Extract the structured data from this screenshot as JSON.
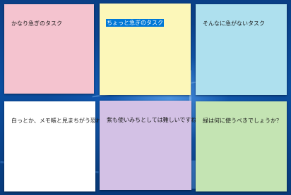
{
  "notes": [
    {
      "text": "かなり急ぎのタスク",
      "color": "#f4c3cf",
      "selected": false
    },
    {
      "text": "ちょっと急ぎのタスク",
      "color": "#fcf7b9",
      "selected": true
    },
    {
      "text": "そんなに急がないタスク",
      "color": "#aee0ee",
      "selected": false
    },
    {
      "text": "白っとか、メモ帳と見まちがう恐れが",
      "color": "#ffffff",
      "selected": false
    },
    {
      "text": "紫も使いみちとしては難しいですね。",
      "color": "#d3c1e5",
      "selected": false
    },
    {
      "text": "緑は何に使うべきでしょうか？",
      "color": "#c4e4b3",
      "selected": false
    }
  ]
}
